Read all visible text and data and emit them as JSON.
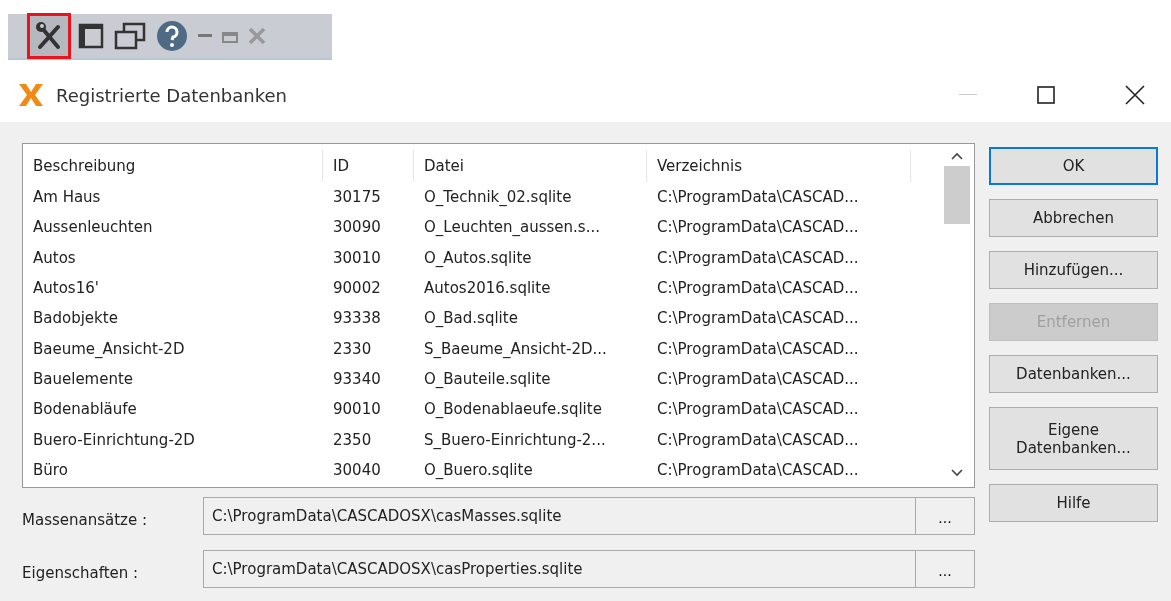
{
  "toolbar": [
    {
      "kind": "tools",
      "selected": true
    },
    {
      "kind": "panel",
      "selected": false
    },
    {
      "kind": "windows",
      "selected": false
    },
    {
      "kind": "help",
      "selected": false
    },
    {
      "kind": "minimize",
      "selected": false
    },
    {
      "kind": "restore",
      "selected": false
    },
    {
      "kind": "close",
      "selected": false
    }
  ],
  "window": {
    "title": "Registrierte Datenbanken"
  },
  "table": {
    "columns": [
      "Beschreibung",
      "ID",
      "Datei",
      "Verzeichnis"
    ],
    "rows": [
      [
        "Am Haus",
        "30175",
        "O_Technik_02.sqlite",
        "C:\\ProgramData\\CASCAD..."
      ],
      [
        "Aussenleuchten",
        "30090",
        "O_Leuchten_aussen.s...",
        "C:\\ProgramData\\CASCAD..."
      ],
      [
        "Autos",
        "30010",
        "O_Autos.sqlite",
        "C:\\ProgramData\\CASCAD..."
      ],
      [
        "Autos16'",
        "90002",
        "Autos2016.sqlite",
        "C:\\ProgramData\\CASCAD..."
      ],
      [
        "Badobjekte",
        "93338",
        "O_Bad.sqlite",
        "C:\\ProgramData\\CASCAD..."
      ],
      [
        "Baeume_Ansicht-2D",
        "2330",
        "S_Baeume_Ansicht-2D...",
        "C:\\ProgramData\\CASCAD..."
      ],
      [
        "Bauelemente",
        "93340",
        "O_Bauteile.sqlite",
        "C:\\ProgramData\\CASCAD..."
      ],
      [
        "Bodenabläufe",
        "90010",
        "O_Bodenablaeufe.sqlite",
        "C:\\ProgramData\\CASCAD..."
      ],
      [
        "Buero-Einrichtung-2D",
        "2350",
        "S_Buero-Einrichtung-2...",
        "C:\\ProgramData\\CASCAD..."
      ],
      [
        "Büro",
        "30040",
        "O_Buero.sqlite",
        "C:\\ProgramData\\CASCAD..."
      ]
    ]
  },
  "buttons": [
    {
      "label": "OK",
      "default": true,
      "disabled": false
    },
    {
      "label": "Abbrechen",
      "default": false,
      "disabled": false
    },
    {
      "label": "Hinzufügen...",
      "default": false,
      "disabled": false
    },
    {
      "label": "Entfernen",
      "default": false,
      "disabled": true
    },
    {
      "label": "Datenbanken...",
      "default": false,
      "disabled": false
    },
    {
      "label": "Eigene Datenbanken...",
      "default": false,
      "disabled": false
    },
    {
      "label": "Hilfe",
      "default": false,
      "disabled": false
    }
  ],
  "fields": [
    {
      "label": "Massenansätze :",
      "value": "C:\\ProgramData\\CASCADOSX\\casMasses.sqlite",
      "button": "..."
    },
    {
      "label": "Eigenschaften :",
      "value": "C:\\ProgramData\\CASCADOSX\\casProperties.sqlite",
      "button": "..."
    }
  ]
}
